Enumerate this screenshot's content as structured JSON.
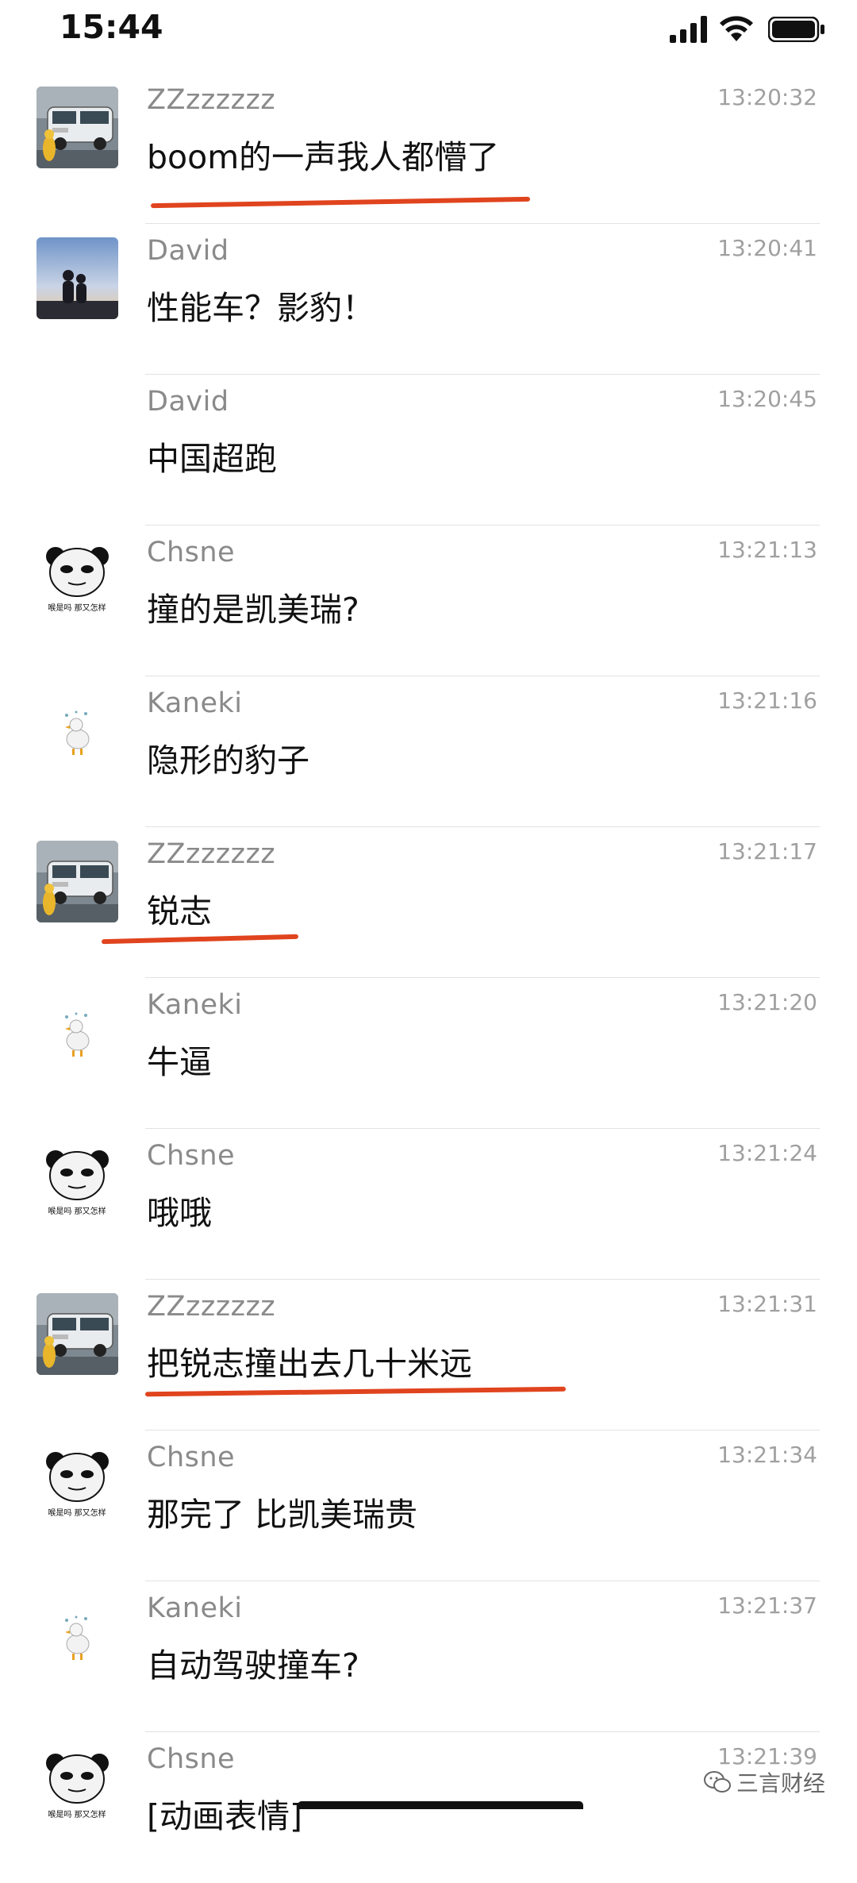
{
  "status_bar": {
    "time": "15:44"
  },
  "messages": [
    {
      "sender": "ZZzzzzzz",
      "time": "13:20:32",
      "text": "boom的一声我人都懵了",
      "avatar": "van",
      "show_avatar": true,
      "underlined": true
    },
    {
      "sender": "David",
      "time": "13:20:41",
      "text": "性能车？影豹！",
      "avatar": "sunset-couple",
      "show_avatar": true,
      "underlined": false
    },
    {
      "sender": "David",
      "time": "13:20:45",
      "text": "中国超跑",
      "avatar": "none",
      "show_avatar": false,
      "underlined": false
    },
    {
      "sender": "Chsne",
      "time": "13:21:13",
      "text": "撞的是凯美瑞?",
      "avatar": "panda-meme",
      "show_avatar": true,
      "underlined": false
    },
    {
      "sender": "Kaneki",
      "time": "13:21:16",
      "text": "隐形的豹子",
      "avatar": "duck",
      "show_avatar": true,
      "underlined": false
    },
    {
      "sender": "ZZzzzzzz",
      "time": "13:21:17",
      "text": "锐志",
      "avatar": "van",
      "show_avatar": true,
      "underlined": true
    },
    {
      "sender": "Kaneki",
      "time": "13:21:20",
      "text": "牛逼",
      "avatar": "duck",
      "show_avatar": true,
      "underlined": false
    },
    {
      "sender": "Chsne",
      "time": "13:21:24",
      "text": "哦哦",
      "avatar": "panda-meme",
      "show_avatar": true,
      "underlined": false
    },
    {
      "sender": "ZZzzzzzz",
      "time": "13:21:31",
      "text": "把锐志撞出去几十米远",
      "avatar": "van",
      "show_avatar": true,
      "underlined": true
    },
    {
      "sender": "Chsne",
      "time": "13:21:34",
      "text": "那完了 比凯美瑞贵",
      "avatar": "panda-meme",
      "show_avatar": true,
      "underlined": false
    },
    {
      "sender": "Kaneki",
      "time": "13:21:37",
      "text": "自动驾驶撞车?",
      "avatar": "duck",
      "show_avatar": true,
      "underlined": false
    },
    {
      "sender": "Chsne",
      "time": "13:21:39",
      "text": "[动画表情]",
      "avatar": "panda-meme",
      "show_avatar": true,
      "underlined": false
    }
  ],
  "panda_caption": "喉是吗 那又怎样",
  "watermark": {
    "text": "三言财经",
    "icon": "wechat-icon"
  },
  "colors": {
    "underline": "#e0441e",
    "sender": "#8a8a8a",
    "time": "#a0a0a0",
    "divider": "#e2e2e2"
  }
}
